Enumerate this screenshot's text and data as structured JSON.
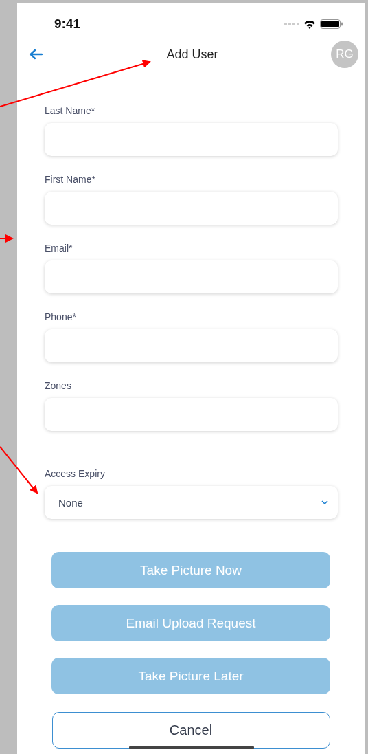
{
  "status_bar": {
    "time": "9:41"
  },
  "header": {
    "title": "Add User",
    "avatar": "RG"
  },
  "fields": [
    {
      "kind": "text",
      "label": "Last Name*"
    },
    {
      "kind": "text",
      "label": "First Name*"
    },
    {
      "kind": "text",
      "label": "Email*"
    },
    {
      "kind": "text",
      "label": "Phone*"
    },
    {
      "kind": "text",
      "label": "Zones"
    },
    {
      "kind": "select",
      "label": "Access Expiry",
      "value": "None"
    }
  ],
  "buttons": [
    {
      "label": "Take Picture Now",
      "disabled": true
    },
    {
      "label": "Email Upload Request",
      "disabled": true
    },
    {
      "label": "Take Picture Later",
      "disabled": true
    }
  ],
  "cancel": {
    "label": "Cancel"
  }
}
